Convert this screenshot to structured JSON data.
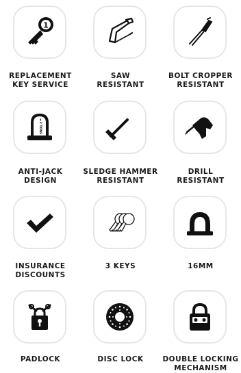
{
  "features": [
    {
      "name": "replacement-key-service",
      "icon": "key-with-number-icon",
      "line1": "REPLACEMENT",
      "line2": "KEY SERVICE"
    },
    {
      "name": "saw-resistant",
      "icon": "hacksaw-icon",
      "line1": "SAW",
      "line2": "RESISTANT"
    },
    {
      "name": "bolt-cropper-resistant",
      "icon": "bolt-cropper-icon",
      "line1": "BOLT CROPPER",
      "line2": "RESISTANT"
    },
    {
      "name": "anti-jack-design",
      "icon": "u-lock-icon",
      "line1": "ANTI-JACK",
      "line2": "DESIGN"
    },
    {
      "name": "sledge-hammer-resistant",
      "icon": "sledge-hammer-icon",
      "line1": "SLEDGE HAMMER",
      "line2": "RESISTANT"
    },
    {
      "name": "drill-resistant",
      "icon": "power-drill-icon",
      "line1": "DRILL",
      "line2": "RESISTANT"
    },
    {
      "name": "insurance-discounts",
      "icon": "checkmark-icon",
      "line1": "INSURANCE",
      "line2": "DISCOUNTS"
    },
    {
      "name": "3-keys",
      "icon": "three-keys-icon",
      "line1": "3 KEYS",
      "line2": ""
    },
    {
      "name": "16mm",
      "icon": "shackle-16mm-icon",
      "line1": "16MM",
      "line2": ""
    },
    {
      "name": "padlock",
      "icon": "padlock-chain-icon",
      "line1": "PADLOCK",
      "line2": ""
    },
    {
      "name": "disc-lock",
      "icon": "disc-lock-icon",
      "line1": "DISC LOCK",
      "line2": ""
    },
    {
      "name": "double-locking-mechanism",
      "icon": "lock-mechanism-icon",
      "line1": "DOUBLE LOCKING",
      "line2": "MECHANISM"
    }
  ],
  "u_lock_text": "◄ 2 TONS ►",
  "key_number": "1",
  "colors": {
    "icon": "#111111",
    "tile_border": "#e6e6e6",
    "label": "#1a1a1a"
  }
}
